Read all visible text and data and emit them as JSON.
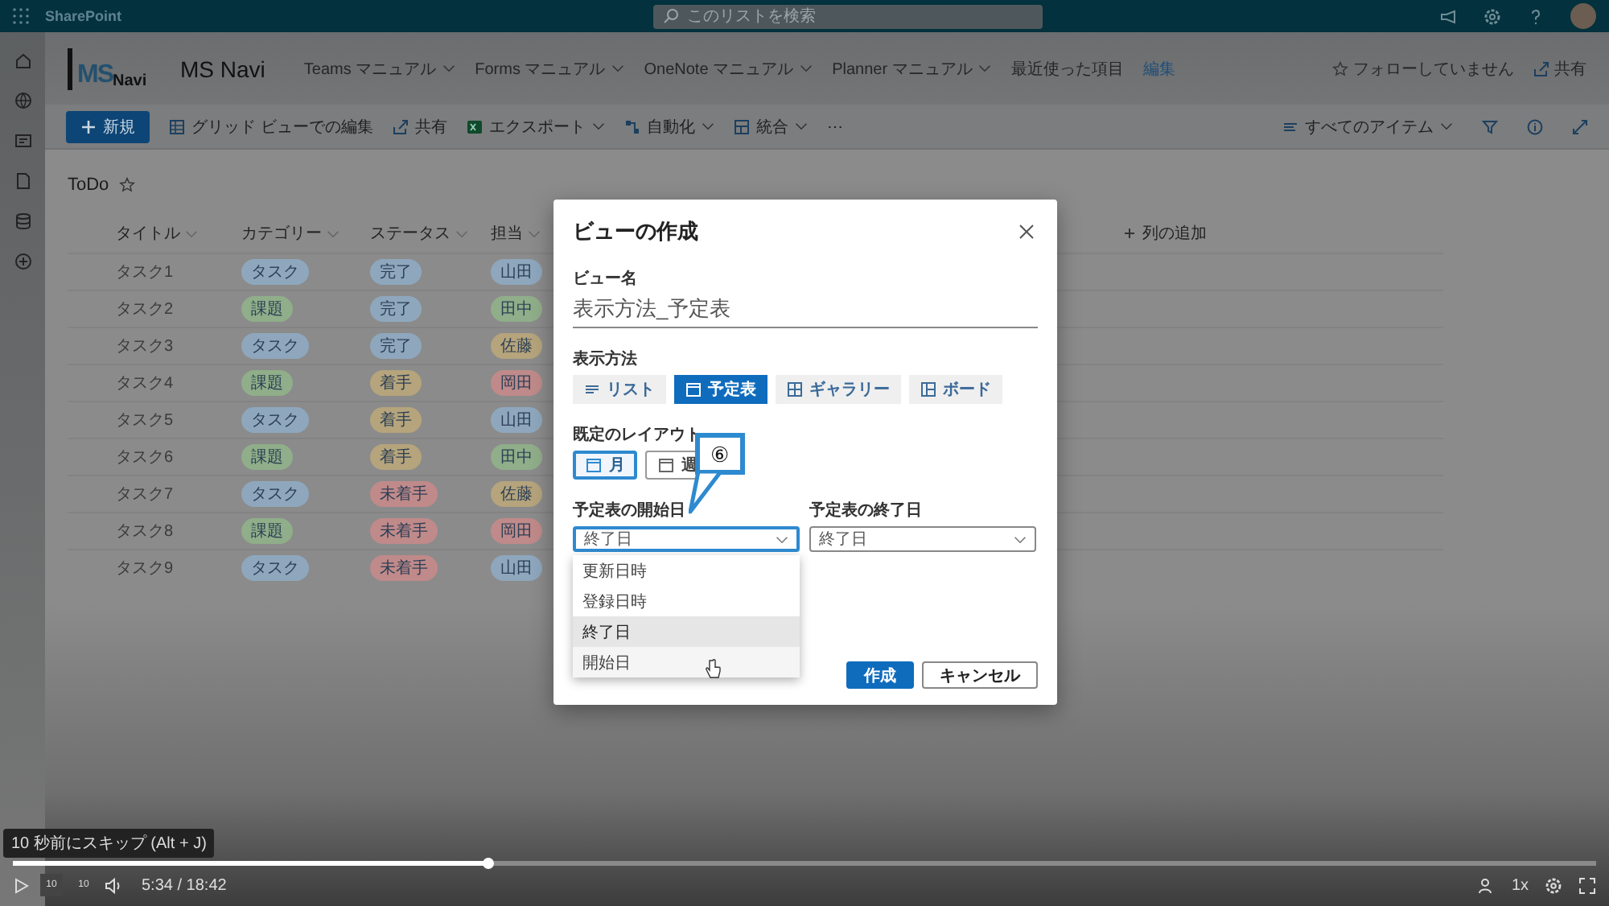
{
  "app_bar": {
    "product": "SharePoint",
    "search": {
      "placeholder": "このリストを検索"
    }
  },
  "site": {
    "logo": {
      "mark": "MS",
      "word": "Navi"
    },
    "title": "MS Navi",
    "nav": [
      {
        "label": "Teams マニュアル",
        "kind": "menu"
      },
      {
        "label": "Forms マニュアル",
        "kind": "menu"
      },
      {
        "label": "OneNote マニュアル",
        "kind": "menu"
      },
      {
        "label": "Planner マニュアル",
        "kind": "menu"
      },
      {
        "label": "最近使った項目",
        "kind": "plain"
      },
      {
        "label": "編集",
        "kind": "link"
      }
    ],
    "follow": "フォローしていません",
    "share": "共有"
  },
  "command_bar": {
    "items": [
      {
        "label": "新規",
        "kind": "primary",
        "dropdown": false
      },
      {
        "label": "グリッド ビューでの編集",
        "kind": "grid",
        "dropdown": false
      },
      {
        "label": "共有",
        "kind": "share",
        "dropdown": false
      },
      {
        "label": "エクスポート",
        "kind": "excel",
        "dropdown": true
      },
      {
        "label": "自動化",
        "kind": "flow",
        "dropdown": true
      },
      {
        "label": "統合",
        "kind": "integrate",
        "dropdown": true
      },
      {
        "label": "⋯",
        "kind": "more",
        "dropdown": false
      }
    ],
    "view": "すべてのアイテム"
  },
  "list": {
    "title": "ToDo",
    "columns": [
      "タイトル",
      "カテゴリー",
      "ステータス",
      "担当"
    ],
    "add_column": "列の追加",
    "rows": [
      {
        "title": "タスク1",
        "category": {
          "label": "タスク",
          "color": "#8ea7bd"
        },
        "status": {
          "label": "完了",
          "color": "#8ea7bd"
        },
        "owner": {
          "label": "山田",
          "color": "#8ea7bd"
        }
      },
      {
        "title": "タスク2",
        "category": {
          "label": "課題",
          "color": "#8fae89"
        },
        "status": {
          "label": "完了",
          "color": "#8ea7bd"
        },
        "owner": {
          "label": "田中",
          "color": "#8fae89"
        }
      },
      {
        "title": "タスク3",
        "category": {
          "label": "タスク",
          "color": "#8ea7bd"
        },
        "status": {
          "label": "完了",
          "color": "#8ea7bd"
        },
        "owner": {
          "label": "佐藤",
          "color": "#b5a47c"
        }
      },
      {
        "title": "タスク4",
        "category": {
          "label": "課題",
          "color": "#8fae89"
        },
        "status": {
          "label": "着手",
          "color": "#b5a47c"
        },
        "owner": {
          "label": "岡田",
          "color": "#c08a8a"
        }
      },
      {
        "title": "タスク5",
        "category": {
          "label": "タスク",
          "color": "#8ea7bd"
        },
        "status": {
          "label": "着手",
          "color": "#b5a47c"
        },
        "owner": {
          "label": "山田",
          "color": "#8ea7bd"
        }
      },
      {
        "title": "タスク6",
        "category": {
          "label": "課題",
          "color": "#8fae89"
        },
        "status": {
          "label": "着手",
          "color": "#b5a47c"
        },
        "owner": {
          "label": "田中",
          "color": "#8fae89"
        }
      },
      {
        "title": "タスク7",
        "category": {
          "label": "タスク",
          "color": "#8ea7bd"
        },
        "status": {
          "label": "未着手",
          "color": "#c08a8a"
        },
        "owner": {
          "label": "佐藤",
          "color": "#b5a47c"
        }
      },
      {
        "title": "タスク8",
        "category": {
          "label": "課題",
          "color": "#8fae89"
        },
        "status": {
          "label": "未着手",
          "color": "#c08a8a"
        },
        "owner": {
          "label": "岡田",
          "color": "#c08a8a"
        }
      },
      {
        "title": "タスク9",
        "category": {
          "label": "タスク",
          "color": "#8ea7bd"
        },
        "status": {
          "label": "未着手",
          "color": "#c08a8a"
        },
        "owner": {
          "label": "山田",
          "color": "#8ea7bd"
        }
      }
    ]
  },
  "dialog": {
    "title": "ビューの作成",
    "name_label": "ビュー名",
    "name_value": "表示方法_予定表",
    "type_label": "表示方法",
    "types": [
      {
        "label": "リスト",
        "kind": "list",
        "selected": false
      },
      {
        "label": "予定表",
        "kind": "calendar",
        "selected": true
      },
      {
        "label": "ギャラリー",
        "kind": "gallery",
        "selected": false
      },
      {
        "label": "ボード",
        "kind": "board",
        "selected": false
      }
    ],
    "layout_label": "既定のレイアウト",
    "layouts": [
      {
        "label": "月",
        "selected": true
      },
      {
        "label": "週",
        "selected": false
      }
    ],
    "start": {
      "label": "予定表の開始日",
      "value": "終了日",
      "annotated": true,
      "options": [
        {
          "label": "更新日時",
          "selected": false,
          "hovered": false
        },
        {
          "label": "登録日時",
          "selected": false,
          "hovered": false
        },
        {
          "label": "終了日",
          "selected": true,
          "hovered": false
        },
        {
          "label": "開始日",
          "selected": false,
          "hovered": true
        }
      ]
    },
    "end": {
      "label": "予定表の終了日",
      "value": "終了日",
      "annotated": false
    },
    "buttons": [
      {
        "label": "作成",
        "kind": "primary"
      },
      {
        "label": "キャンセル",
        "kind": "default"
      }
    ],
    "callout": {
      "text": "⑥"
    }
  },
  "player": {
    "tooltip": "10 秒前にスキップ (Alt + J)",
    "level": 0.3,
    "skip_back": "10",
    "skip_forward": "10",
    "time": "5:34 / 18:42",
    "speed": "1x"
  }
}
